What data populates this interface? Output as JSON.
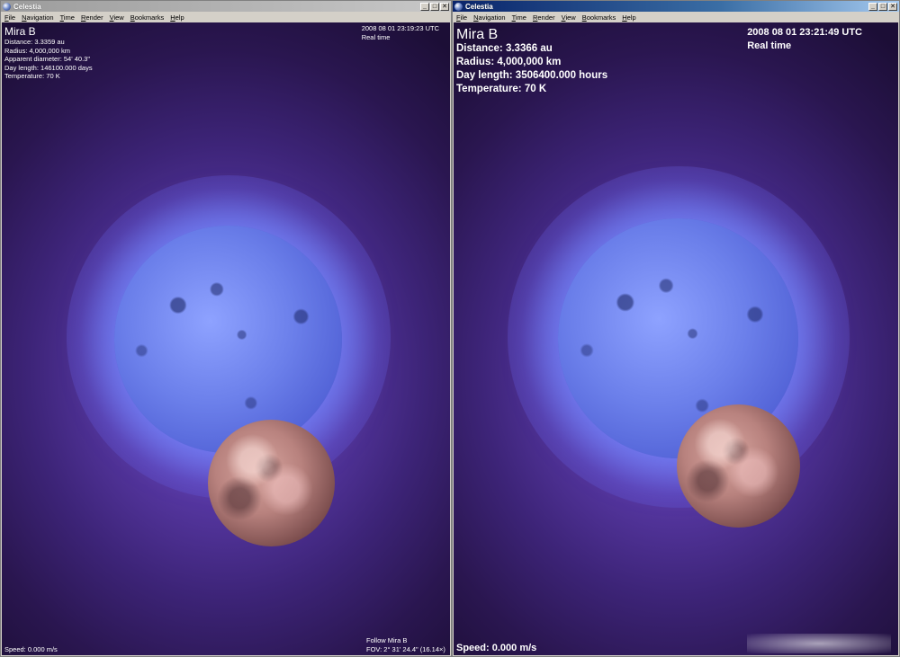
{
  "left_window": {
    "title": "Celestia",
    "menu": [
      "File",
      "Navigation",
      "Time",
      "Render",
      "View",
      "Bookmarks",
      "Help"
    ],
    "controls": {
      "minimize": "_",
      "maximize": "□",
      "close": "✕"
    },
    "object_name": "Mira B",
    "info": [
      "Distance: 3.3359 au",
      "Radius: 4,000,000 km",
      "Apparent diameter: 54' 40.3\"",
      "Day length: 146100.000 days",
      "Temperature: 70 K"
    ],
    "datetime": "2008 08 01 23:19:23 UTC",
    "time_mode": "Real time",
    "speed": "Speed: 0.000 m/s",
    "follow": "Follow Mira B",
    "fov": "FOV: 2° 31' 24.4\" (16.14×)"
  },
  "right_window": {
    "title": "Celestia",
    "menu": [
      "File",
      "Navigation",
      "Time",
      "Render",
      "View",
      "Bookmarks",
      "Help"
    ],
    "controls": {
      "minimize": "_",
      "maximize": "□",
      "close": "✕"
    },
    "object_name": "Mira B",
    "info": [
      "Distance: 3.3366 au",
      "Radius: 4,000,000 km",
      "Day length: 3506400.000 hours",
      "Temperature: 70 K"
    ],
    "datetime": "2008 08 01 23:21:49 UTC",
    "time_mode": "Real time",
    "speed": "Speed: 0.000 m/s"
  },
  "icons": [
    "celestia-app-icon",
    "minimize-icon",
    "maximize-icon",
    "close-icon"
  ],
  "colors": {
    "space_purple": "#3d2478",
    "star_blue": "#6b7fea",
    "planet_rose": "#b8827e",
    "hud_text": "#ffffff"
  }
}
